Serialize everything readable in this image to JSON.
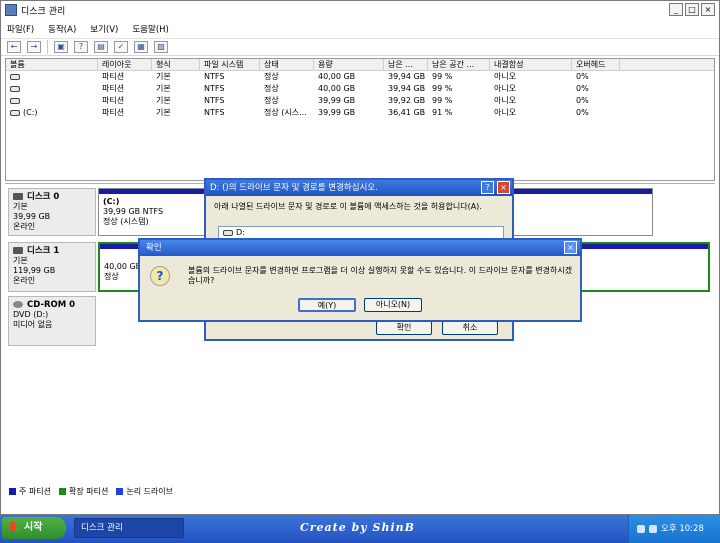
{
  "window": {
    "title": "디스크 관리",
    "controls": [
      "_",
      "□",
      "×"
    ]
  },
  "menu": [
    "파일(F)",
    "동작(A)",
    "보기(V)",
    "도움말(H)"
  ],
  "toolbar": [
    "←",
    "→",
    "▣",
    "?",
    "▤",
    "✓",
    "▦",
    "▧"
  ],
  "volume_table": {
    "headers": [
      "볼륨",
      "레이아웃",
      "형식",
      "파일 시스템",
      "상태",
      "용량",
      "남은 ...",
      "남은 공간 ...",
      "내결함성",
      "오버헤드"
    ],
    "rows": [
      [
        "",
        "파티션",
        "기본",
        "NTFS",
        "정상",
        "40,00 GB",
        "39,94 GB",
        "99 %",
        "아니오",
        "0%"
      ],
      [
        "",
        "파티션",
        "기본",
        "NTFS",
        "정상",
        "40,00 GB",
        "39,94 GB",
        "99 %",
        "아니오",
        "0%"
      ],
      [
        "",
        "파티션",
        "기본",
        "NTFS",
        "정상",
        "39,99 GB",
        "39,92 GB",
        "99 %",
        "아니오",
        "0%"
      ],
      [
        "(C:)",
        "파티션",
        "기본",
        "NTFS",
        "정상 (시스...",
        "39,99 GB",
        "36,41 GB",
        "91 %",
        "아니오",
        "0%"
      ]
    ]
  },
  "disks": [
    {
      "name": "디스크 0",
      "lines": [
        "기본",
        "39,99 GB",
        "온라인"
      ],
      "partition": [
        "(C:)",
        "39,99 GB NTFS",
        "정상 (시스템)"
      ]
    },
    {
      "name": "디스크 1",
      "lines": [
        "기본",
        "119,99 GB",
        "온라인"
      ],
      "partition": [
        "40,00 GB",
        "정상"
      ]
    },
    {
      "name": "CD-ROM 0",
      "lines": [
        "DVD (D:)",
        "",
        "미디어 없음"
      ]
    }
  ],
  "legend": [
    {
      "label": "주 파티션",
      "color": "#1a1aa8"
    },
    {
      "label": "확장 파티션",
      "color": "#1a8a1a"
    },
    {
      "label": "논리 드라이브",
      "color": "#1f3fe0"
    }
  ],
  "dialog_change": {
    "title": "D: ()의 드라이브 문자 및 경로를 변경하십시오.",
    "help": "?",
    "close": "×",
    "message": "아래 나열된 드라이브 문자 및 경로로 이 볼륨에 액세스하는 것을 허용합니다(A).",
    "list_item": "D:",
    "ok": "확인",
    "cancel": "취소"
  },
  "dialog_confirm": {
    "title": "확인",
    "close": "×",
    "icon": "?",
    "message": "볼륨의 드라이브 문자를 변경하면 프로그램을 더 이상 실행하지 못할 수도 있습니다. 이 드라이브 문자를 변경하시겠습니까?",
    "yes": "예(Y)",
    "no": "아니오(N)"
  },
  "taskbar": {
    "start": "시작",
    "task": "디스크 관리",
    "brand": "Create by ShinB",
    "clock": "오후 10:28"
  }
}
